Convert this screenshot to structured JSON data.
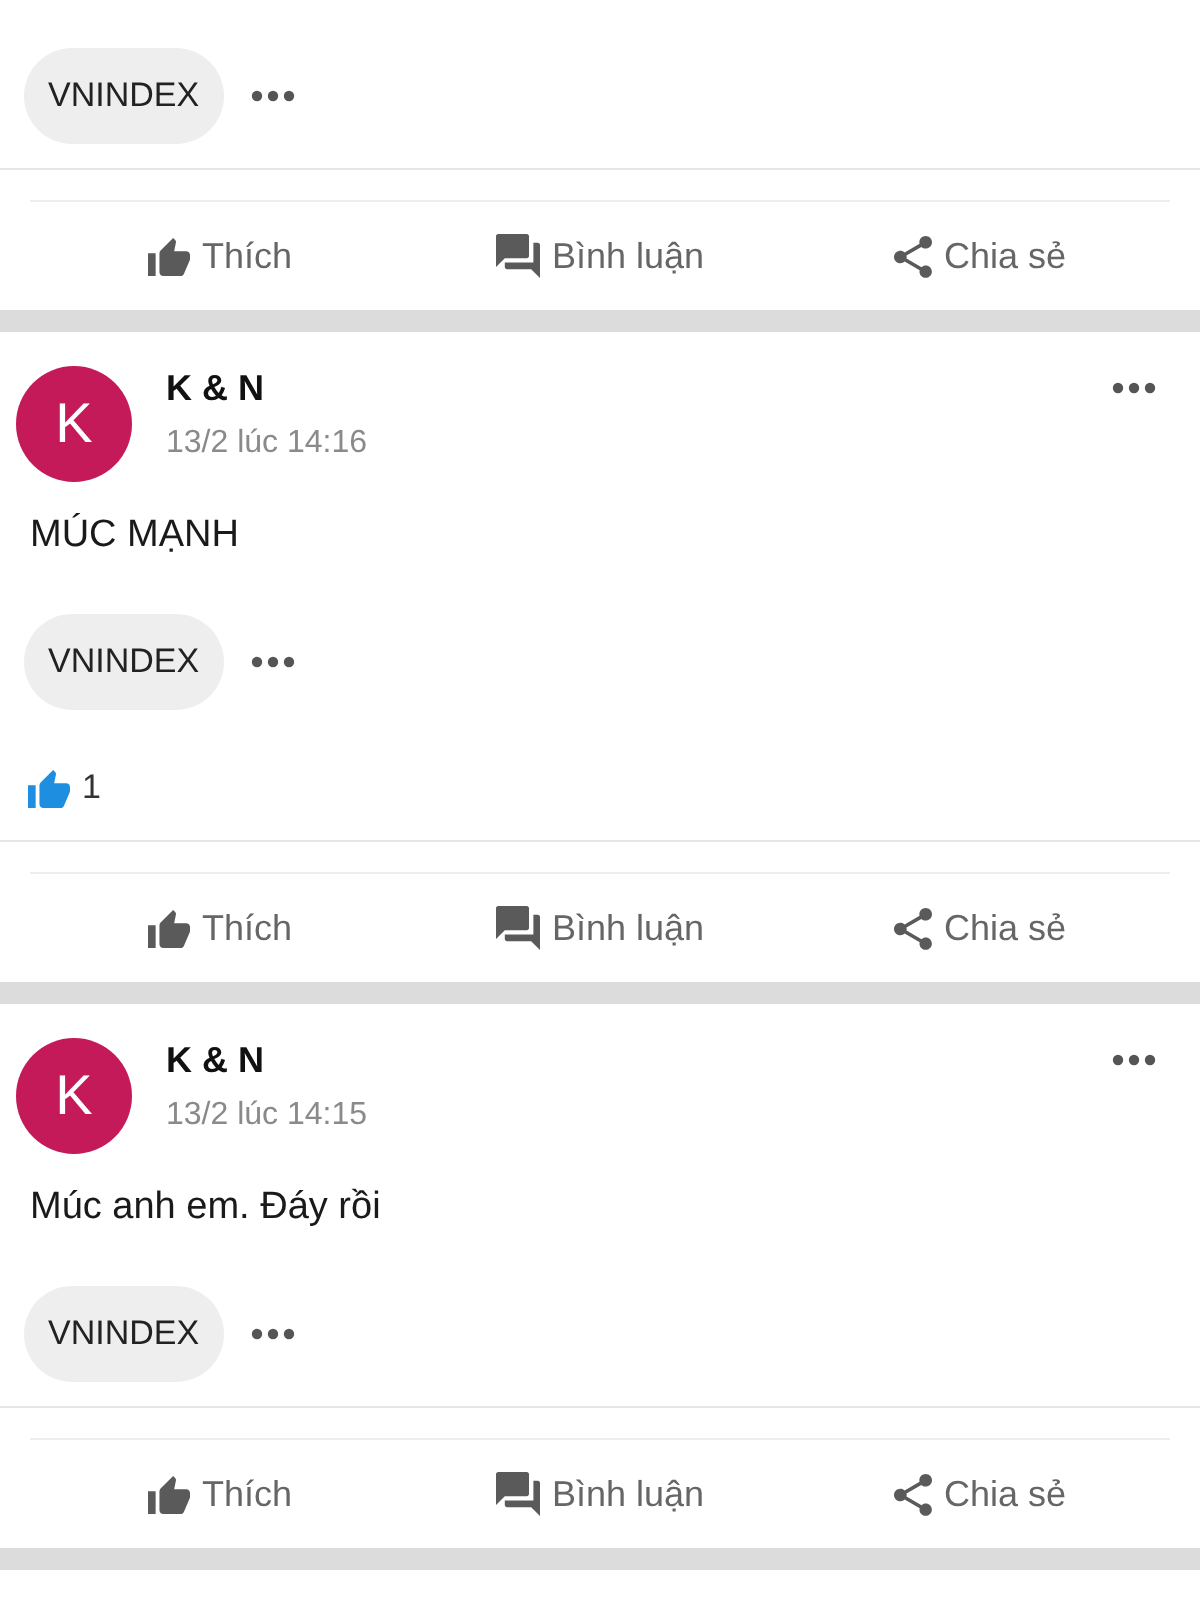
{
  "posts": [
    {
      "tags": [
        "VNINDEX"
      ],
      "actions": [
        {
          "kind": "like",
          "label": "Thích"
        },
        {
          "kind": "comment",
          "label": "Bình luận"
        },
        {
          "kind": "share",
          "label": "Chia sẻ"
        }
      ]
    },
    {
      "author": {
        "name": "K & N",
        "initial": "K"
      },
      "time": "13/2 lúc 14:16",
      "text": "MÚC MẠNH",
      "tags": [
        "VNINDEX"
      ],
      "reactions": {
        "count": "1"
      },
      "actions": [
        {
          "kind": "like",
          "label": "Thích"
        },
        {
          "kind": "comment",
          "label": "Bình luận"
        },
        {
          "kind": "share",
          "label": "Chia sẻ"
        }
      ]
    },
    {
      "author": {
        "name": "K & N",
        "initial": "K"
      },
      "time": "13/2 lúc 14:15",
      "text": "Múc anh em. Đáy rồi",
      "tags": [
        "VNINDEX"
      ],
      "actions": [
        {
          "kind": "like",
          "label": "Thích"
        },
        {
          "kind": "comment",
          "label": "Bình luận"
        },
        {
          "kind": "share",
          "label": "Chia sẻ"
        }
      ]
    }
  ]
}
